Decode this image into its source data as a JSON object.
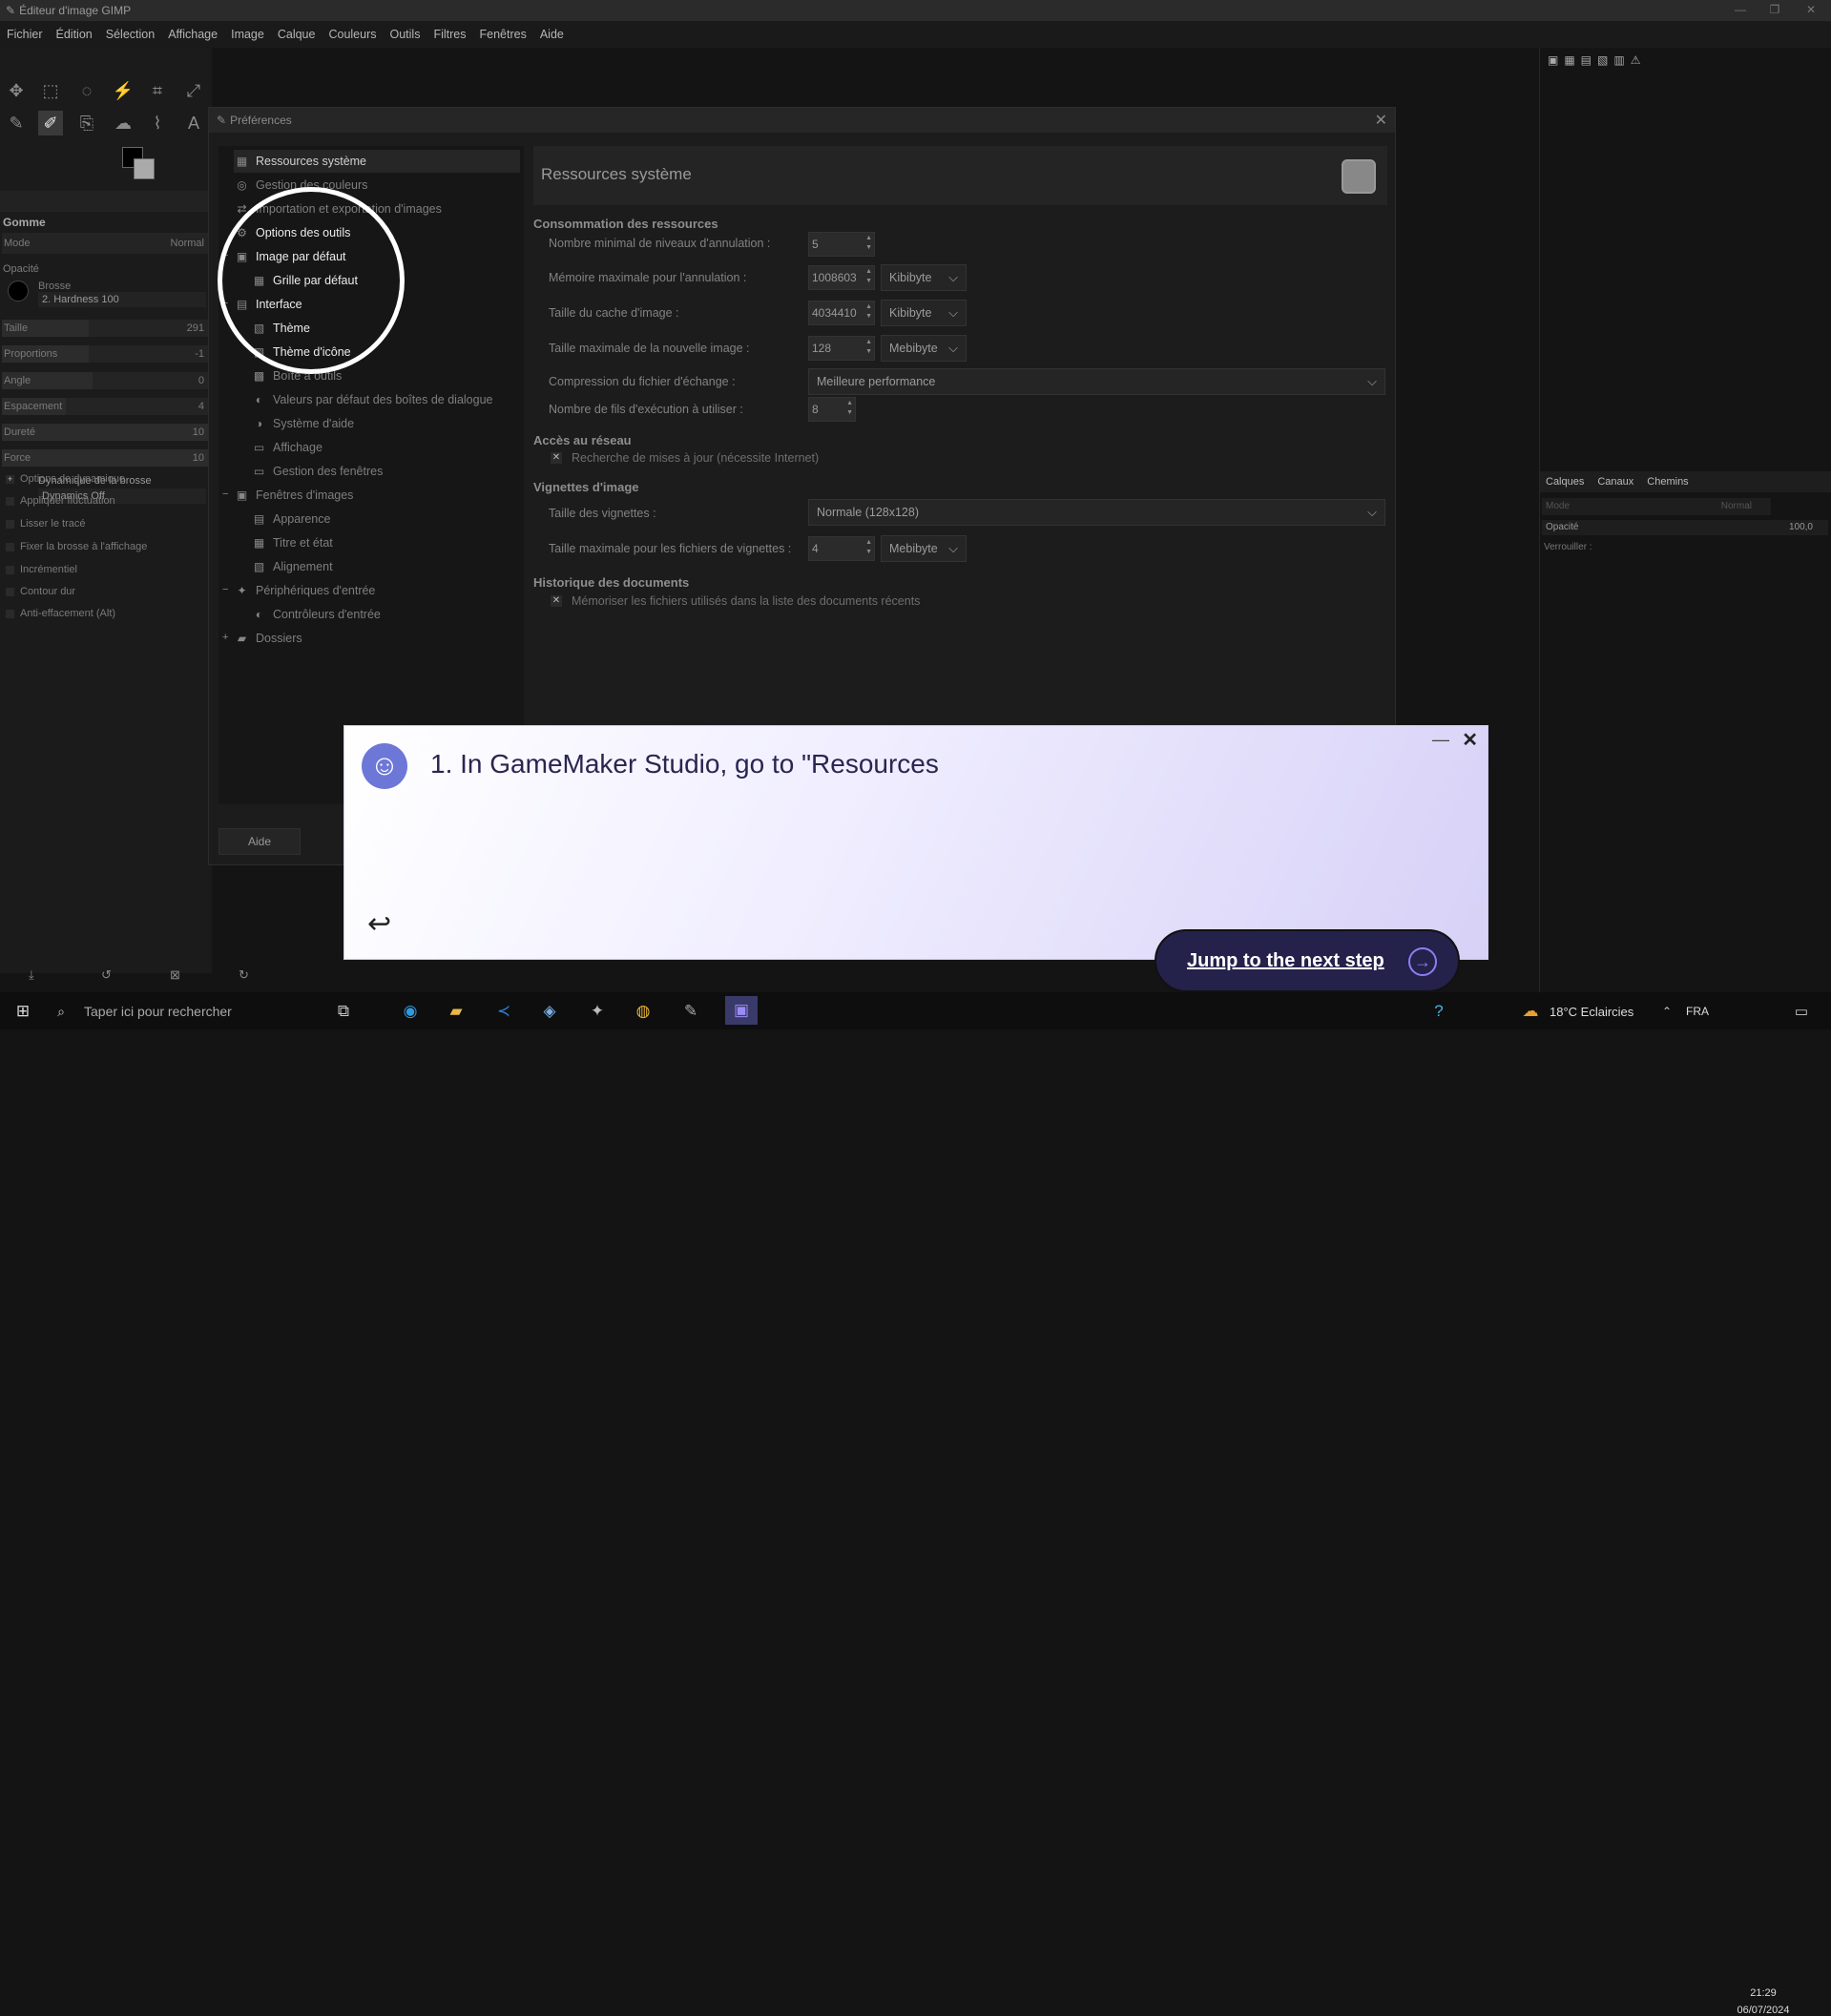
{
  "window": {
    "title": "Éditeur d'image GIMP"
  },
  "menubar": [
    "Fichier",
    "Édition",
    "Sélection",
    "Affichage",
    "Image",
    "Calque",
    "Couleurs",
    "Outils",
    "Filtres",
    "Fenêtres",
    "Aide"
  ],
  "toolbox": {
    "tool_name": "Gomme",
    "mode_label": "Mode",
    "mode_value": "Normal",
    "opacity_label": "Opacité",
    "brush_label": "Brosse",
    "brush_value": "2. Hardness 100",
    "sliders": [
      {
        "label": "Taille",
        "value": "291",
        "fill": 0.42
      },
      {
        "label": "Proportions",
        "value": "-1",
        "fill": 0.42
      },
      {
        "label": "Angle",
        "value": "0",
        "fill": 0.44
      },
      {
        "label": "Espacement",
        "value": "4",
        "fill": 0.31
      },
      {
        "label": "Dureté",
        "value": "10",
        "fill": 1.0
      },
      {
        "label": "Force",
        "value": "10",
        "fill": 1.0
      }
    ],
    "dynamics_label": "Dynamique de la brosse",
    "dynamics_value": "Dynamics Off",
    "options": [
      "Options de dynamique",
      "Appliquer fluctuation",
      "Lisser le tracé",
      "Fixer la brosse à l'affichage",
      "Incrémentiel",
      "Contour dur",
      "Anti-effacement (Alt)"
    ]
  },
  "right_dock": {
    "tabs": [
      "Calques",
      "Canaux",
      "Chemins"
    ],
    "mode_label": "Mode",
    "mode_value": "Normal",
    "opacity_label": "Opacité",
    "opacity_value": "100,0",
    "lock_label": "Verrouiller :"
  },
  "prefs": {
    "title": "Préférences",
    "tree": [
      {
        "label": "Ressources système",
        "icon": "chip-icon"
      },
      {
        "label": "Gestion des couleurs",
        "icon": "color-icon"
      },
      {
        "label": "Importation et exportation d'images",
        "icon": "import-icon"
      },
      {
        "label": "Options des outils",
        "icon": "tool-options-icon"
      },
      {
        "label": "Image par défaut",
        "icon": "image-icon"
      },
      {
        "label": "Grille par défaut",
        "icon": "grid-icon"
      },
      {
        "label": "Interface",
        "icon": "interface-icon"
      },
      {
        "label": "Thème",
        "icon": "theme-icon"
      },
      {
        "label": "Thème d'icône",
        "icon": "icon-theme-icon"
      },
      {
        "label": "Boîte à outils",
        "icon": "toolbox-icon"
      },
      {
        "label": "Valeurs par défaut des boîtes de dialogue",
        "icon": "dialog-icon"
      },
      {
        "label": "Système d'aide",
        "icon": "help-icon"
      },
      {
        "label": "Affichage",
        "icon": "display-icon"
      },
      {
        "label": "Gestion des fenêtres",
        "icon": "windows-icon"
      },
      {
        "label": "Fenêtres d'images",
        "icon": "image-window-icon"
      },
      {
        "label": "Apparence",
        "icon": "appearance-icon"
      },
      {
        "label": "Titre et état",
        "icon": "title-icon"
      },
      {
        "label": "Alignement",
        "icon": "align-icon"
      },
      {
        "label": "Périphériques d'entrée",
        "icon": "input-devices-icon"
      },
      {
        "label": "Contrôleurs d'entrée",
        "icon": "controllers-icon"
      },
      {
        "label": "Dossiers",
        "icon": "folder-icon"
      }
    ],
    "help_button": "Aide",
    "page_title": "Ressources système",
    "sections": {
      "resources": "Consommation des ressources",
      "network": "Accès au réseau",
      "thumbnails": "Vignettes d'image",
      "history": "Historique des documents"
    },
    "fields": {
      "undo_levels_label": "Nombre minimal de niveaux d'annulation :",
      "undo_levels_value": "5",
      "undo_memory_label": "Mémoire maximale pour l'annulation :",
      "undo_memory_value": "1008603",
      "undo_memory_unit": "Kibibyte",
      "cache_label": "Taille du cache d'image :",
      "cache_value": "4034410",
      "cache_unit": "Kibibyte",
      "max_image_label": "Taille maximale de la nouvelle image :",
      "max_image_value": "128",
      "max_image_unit": "Mebibyte",
      "swap_label": "Compression du fichier d'échange :",
      "swap_value": "Meilleure performance",
      "threads_label": "Nombre de fils d'exécution à utiliser :",
      "threads_value": "8",
      "update_check": "Recherche de mises à jour (nécessite Internet)",
      "thumb_size_label": "Taille des vignettes :",
      "thumb_size_value": "Normale (128x128)",
      "thumb_max_label": "Taille maximale pour les fichiers de vignettes :",
      "thumb_max_value": "4",
      "thumb_max_unit": "Mebibyte",
      "recent_check": "Mémoriser les fichiers utilisés dans la liste des documents récents"
    }
  },
  "guide": {
    "step_text": "1. In GameMaker Studio, go to \"Resources",
    "next_button": "Jump to the next step"
  },
  "taskbar": {
    "search_placeholder": "Taper ici pour rechercher",
    "weather": "18°C  Eclaircies",
    "lang": "FRA",
    "time": "21:29",
    "date": "06/07/2024"
  }
}
